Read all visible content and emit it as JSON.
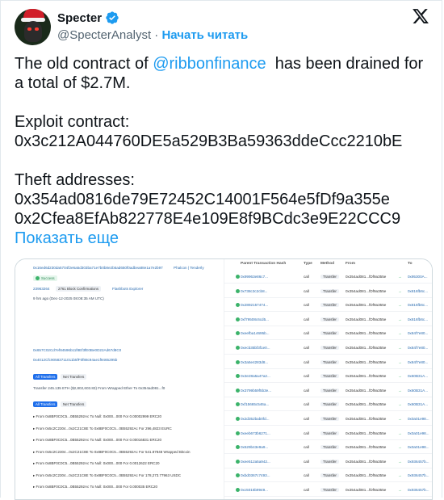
{
  "header": {
    "name": "Specter",
    "handle": "@SpecterAnalyst",
    "separator": "·",
    "follow_label": "Начать читать"
  },
  "tweet": {
    "line1_before": "The old contract of ",
    "mention": "@ribbonfinance",
    "line1_after": "  has been drained for a total of $2.7M.",
    "exploit_label": "Exploit contract:",
    "exploit_address": "0x3c212A044760DE5a529B3Ba59363ddeCcc2210bE",
    "theft_label": "Theft addresses:",
    "theft_1": "0x354ad0816de79E72452C14001F564e5fDf9a355e",
    "theft_2": "0x2Cfea8EfAb822778E4e109E8f9BCdc3e9E22CCC9",
    "show_more": "Показать еще"
  },
  "screenshot": {
    "tx_hash": "0x16ed6d230da5704f2e6a5d303ba71e7b0b8e2b5ad650f0adbea88e1a7e2b97",
    "explorer_links": "Phalcon | Tenderly",
    "status": "Success",
    "block": "23963264",
    "confirmations": "2761 Block Confirmations",
    "flashbots": "Flashbots Explorer",
    "time": "9 hrs ago (Dec-12-2025 08:08:35 AM UTC)",
    "contract_1": "0x657C02Cd7ef84596b11f8Ef3fE0Be0D22Ad67d8C0",
    "contract_2": "0x4012Cfc90583711011b5fF0f88c94ae1f9465295b",
    "tab_all": "All Transfers",
    "tab_net": "Net Transfers",
    "transfer_line": "Transfer 245.135 ETH ($2,802,603.83) From Wrapped Ether To 0x354ad081...f0",
    "columns": {
      "parent": "Parent Transaction Hash",
      "type": "Type",
      "method": "Method",
      "from": "From",
      "to": "To"
    },
    "rows": [
      {
        "hash": "0x99963e86c7...",
        "type": "call",
        "method": "Transfer",
        "from": "0x354ad081...fDf9a355e",
        "to": "0x95300A..."
      },
      {
        "hash": "0x738c3c2cb8...",
        "type": "call",
        "method": "Transfer",
        "from": "0x354ad081...fDf9a355e",
        "to": "0x816fb6c..."
      },
      {
        "hash": "0x2892157474...",
        "type": "call",
        "method": "Transfer",
        "from": "0x354ad081...fDf9a355e",
        "to": "0x816fb6c..."
      },
      {
        "hash": "0xf79508c6cd5...",
        "type": "call",
        "method": "Transfer",
        "from": "0x354ad081...fDf9a355e",
        "to": "0x816fb6c..."
      },
      {
        "hash": "0xeefba14695b...",
        "type": "call",
        "method": "Transfer",
        "from": "0x354ad081...fDf9a355e",
        "to": "0x84f7e80..."
      },
      {
        "hash": "0xecb35bf3f1e0...",
        "type": "call",
        "method": "Transfer",
        "from": "0x354ad081...fDf9a355e",
        "to": "0x84f7e80..."
      },
      {
        "hash": "0x3a5e4283d8...",
        "type": "call",
        "method": "Transfer",
        "from": "0x354ad081...fDf9a355e",
        "to": "0x84f7e80..."
      },
      {
        "hash": "0x3e28a5a47a2...",
        "type": "call",
        "method": "Transfer",
        "from": "0x354ad081...fDf9a355e",
        "to": "0x60B31A..."
      },
      {
        "hash": "0x3799b59f5b3e...",
        "type": "call",
        "method": "Transfer",
        "from": "0x354ad081...fDf9a355e",
        "to": "0x60B31A..."
      },
      {
        "hash": "0xf15665c546a...",
        "type": "call",
        "method": "Transfer",
        "from": "0x354ad081...fDf9a355e",
        "to": "0x60B31A..."
      },
      {
        "hash": "0x2d352bab0fd...",
        "type": "call",
        "method": "Transfer",
        "from": "0x354ad081...fDf9a355e",
        "to": "0x0a01e98..."
      },
      {
        "hash": "0xeeb673b6271...",
        "type": "call",
        "method": "Transfer",
        "from": "0x354ad081...fDf9a355e",
        "to": "0x0a01e98..."
      },
      {
        "hash": "0x529b43e9a9...",
        "type": "call",
        "method": "Transfer",
        "from": "0x354ad081...fDf9a355e",
        "to": "0x0a01e98..."
      },
      {
        "hash": "0xee512a5a942...",
        "type": "call",
        "method": "Transfer",
        "from": "0x354ad081...fDf9a355e",
        "to": "0x936457b..."
      },
      {
        "hash": "0xbd0367c7493...",
        "type": "call",
        "method": "Transfer",
        "from": "0x354ad081...fDf9a355e",
        "to": "0x936457b..."
      },
      {
        "hash": "0xc5015b9949...",
        "type": "call",
        "method": "Transfer",
        "from": "0x354ad081...fDf9a355e",
        "to": "0x936457b..."
      }
    ],
    "left_transfers": [
      "From 0x8BF0C0C5...0B55292Ac To Null: 0x000...000 For 0.00002999 ERC20",
      "From 0x5c2C2304...0x2C21C8E To 0x8BF0C0C5...0B55292Ac For 296,4823 EURC",
      "From 0x8BF0C0C5...0B55292Ac To Null: 0x000...000 For 0.00016831 ERC20",
      "From 0x5c2C2304...0x2C21C8E To 0x8BF0C0C5...0B55292Ac For 541.87848 Wrapped Bitcoin",
      "From 0x8BF0C0C5...0B55292Ac To Null: 0x000...000 For 0.0012622 ERC20",
      "From 0x5c2C2304...0x2C21C8E To 0x8BF0C0C5...0B55292Ac For 178,273.77963 USDC",
      "From 0x8BF0C0C5...0B55292Ac To Null: 0x000...000 For 0.000035 ERC20"
    ],
    "net_label": "Net Transfers"
  },
  "colors": {
    "accent": "#1d9bf0",
    "text": "#0f1419",
    "secondary": "#536471",
    "success": "#3bb36a"
  }
}
